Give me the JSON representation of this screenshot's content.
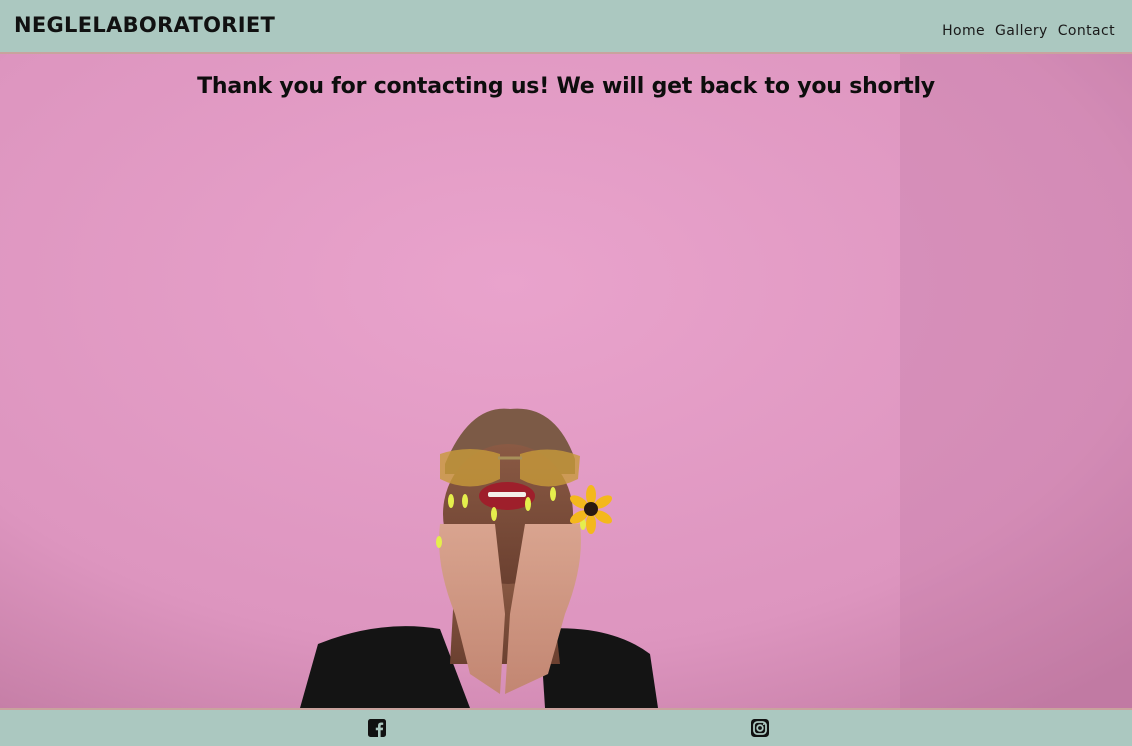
{
  "header": {
    "brand": "NEGLELABORATORIET",
    "nav": [
      {
        "label": "Home"
      },
      {
        "label": "Gallery"
      },
      {
        "label": "Contact"
      }
    ]
  },
  "hero": {
    "message": "Thank you for contacting us! We will get back to you shortly",
    "background_color": "#e29dc6"
  },
  "footer": {
    "social": [
      {
        "icon": "facebook-icon"
      },
      {
        "icon": "instagram-icon"
      }
    ]
  },
  "colors": {
    "bar": "#abc8c0",
    "bar_border": "#c9a39e",
    "text": "#111111"
  }
}
